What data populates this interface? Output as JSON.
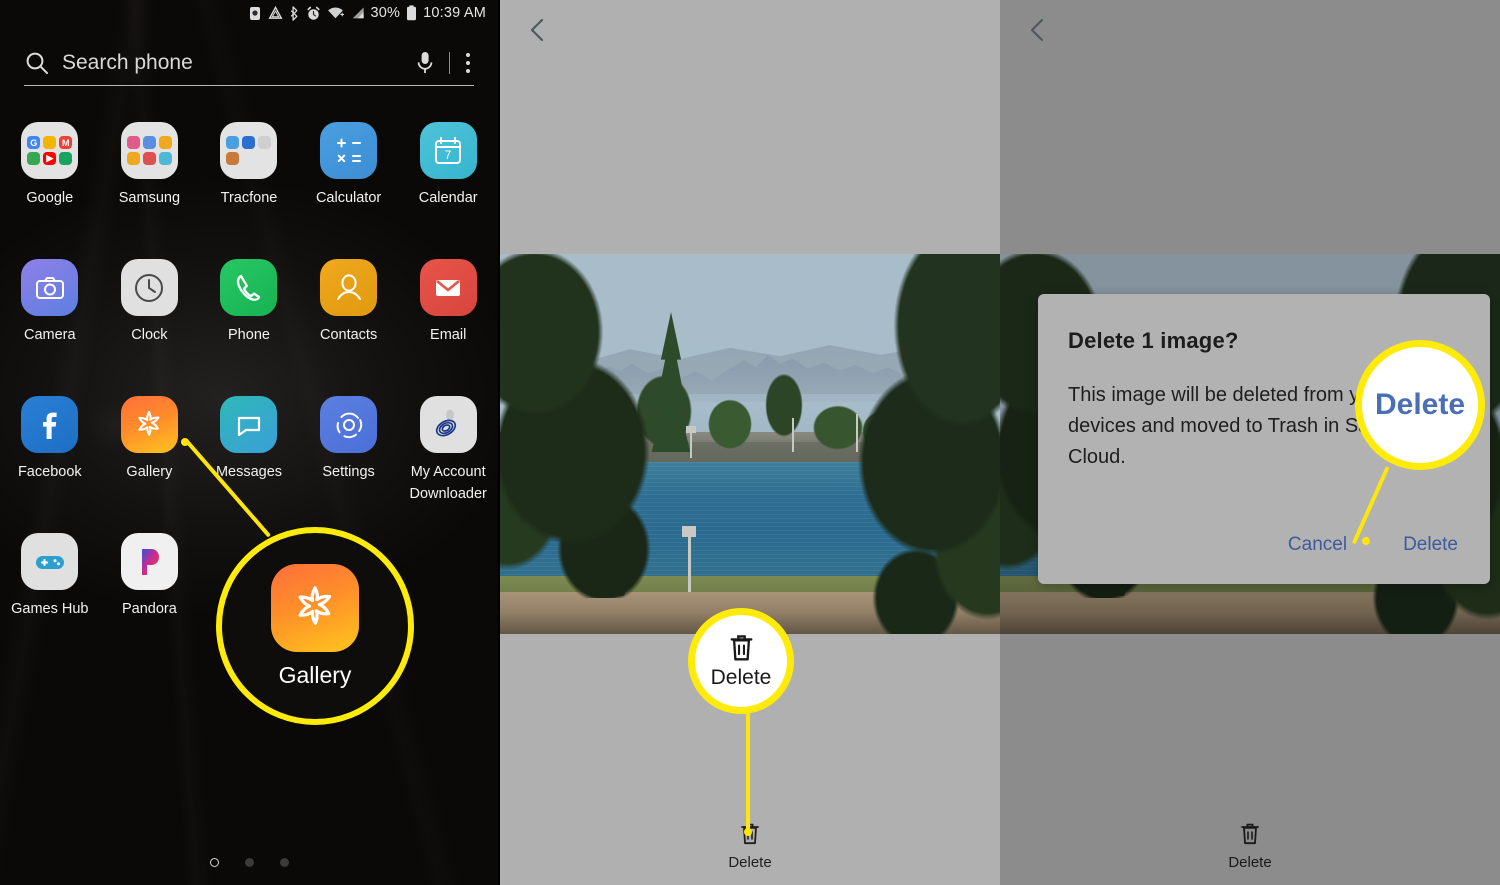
{
  "panel1": {
    "name": "home-screen",
    "statusbar": {
      "battery_percent": "30%",
      "time": "10:39 AM",
      "icons": [
        "battery-saver-icon",
        "power-save-icon",
        "bluetooth-icon",
        "alarm-icon",
        "wifi-icon",
        "signal-icon",
        "battery-icon"
      ]
    },
    "search": {
      "placeholder": "Search phone",
      "icons": [
        "search-icon",
        "microphone-icon",
        "more-options-icon"
      ]
    },
    "apps": [
      {
        "label": "Google",
        "icon": "google-folder-icon",
        "kind": "folder"
      },
      {
        "label": "Samsung",
        "icon": "samsung-folder-icon",
        "kind": "folder"
      },
      {
        "label": "Tracfone",
        "icon": "tracfone-folder-icon",
        "kind": "folder"
      },
      {
        "label": "Calculator",
        "icon": "calculator-icon",
        "kind": "app"
      },
      {
        "label": "Calendar",
        "icon": "calendar-icon",
        "kind": "app"
      },
      {
        "label": "Camera",
        "icon": "camera-icon",
        "kind": "app"
      },
      {
        "label": "Clock",
        "icon": "clock-icon",
        "kind": "app"
      },
      {
        "label": "Phone",
        "icon": "phone-icon",
        "kind": "app"
      },
      {
        "label": "Contacts",
        "icon": "contacts-icon",
        "kind": "app"
      },
      {
        "label": "Email",
        "icon": "email-icon",
        "kind": "app"
      },
      {
        "label": "Facebook",
        "icon": "facebook-icon",
        "kind": "app"
      },
      {
        "label": "Gallery",
        "icon": "gallery-icon",
        "kind": "app"
      },
      {
        "label": "Messages",
        "icon": "messages-icon",
        "kind": "app"
      },
      {
        "label": "Settings",
        "icon": "settings-icon",
        "kind": "app"
      },
      {
        "label": "My Account\nDownloader",
        "icon": "my-account-downloader-icon",
        "kind": "app"
      },
      {
        "label": "Games Hub",
        "icon": "games-hub-icon",
        "kind": "app"
      },
      {
        "label": "Pandora",
        "icon": "pandora-icon",
        "kind": "app"
      }
    ],
    "calendar_day": "7",
    "page_dots": {
      "count": 3,
      "active_index": 0
    }
  },
  "panel2": {
    "name": "photo-viewer",
    "back_icon": "back-chevron-icon",
    "bottom_bar": {
      "label": "Delete",
      "icon": "trash-icon"
    },
    "callout": {
      "label": "Delete",
      "icon": "trash-icon"
    }
  },
  "panel3": {
    "name": "photo-viewer-with-dialog",
    "back_icon": "back-chevron-icon",
    "bottom_bar": {
      "label": "Delete",
      "icon": "trash-icon"
    },
    "dialog": {
      "title": "Delete 1 image?",
      "body": "This image will be deleted from your synced devices and moved to Trash in Samsung Cloud.",
      "cancel_label": "Cancel",
      "confirm_label": "Delete"
    },
    "callout": {
      "label": "Delete"
    }
  },
  "colors": {
    "highlight_yellow": "#ffeb0a",
    "panel2_bg": "#b0b0b0",
    "panel3_bg": "#8c8c8c",
    "dialog_bg": "#b2b2b2",
    "link_blue": "#3c5a9e",
    "callout_blue": "#4a6fb5"
  }
}
